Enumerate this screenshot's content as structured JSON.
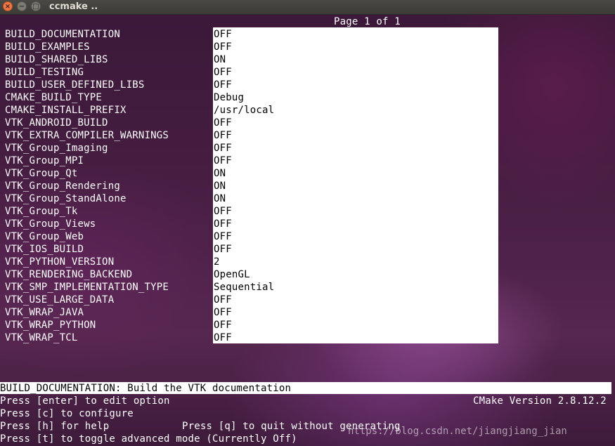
{
  "window": {
    "title": "ccmake ..",
    "close_glyph": "×",
    "minimize_glyph": "−",
    "maximize_glyph": "□"
  },
  "page_indicator": "Page 1 of 1",
  "options": [
    {
      "name": "BUILD_DOCUMENTATION",
      "value": "OFF"
    },
    {
      "name": "BUILD_EXAMPLES",
      "value": "OFF"
    },
    {
      "name": "BUILD_SHARED_LIBS",
      "value": "ON"
    },
    {
      "name": "BUILD_TESTING",
      "value": "OFF"
    },
    {
      "name": "BUILD_USER_DEFINED_LIBS",
      "value": "OFF"
    },
    {
      "name": "CMAKE_BUILD_TYPE",
      "value": "Debug"
    },
    {
      "name": "CMAKE_INSTALL_PREFIX",
      "value": "/usr/local"
    },
    {
      "name": "VTK_ANDROID_BUILD",
      "value": "OFF"
    },
    {
      "name": "VTK_EXTRA_COMPILER_WARNINGS",
      "value": "OFF"
    },
    {
      "name": "VTK_Group_Imaging",
      "value": "OFF"
    },
    {
      "name": "VTK_Group_MPI",
      "value": "OFF"
    },
    {
      "name": "VTK_Group_Qt",
      "value": "ON"
    },
    {
      "name": "VTK_Group_Rendering",
      "value": "ON"
    },
    {
      "name": "VTK_Group_StandAlone",
      "value": "ON"
    },
    {
      "name": "VTK_Group_Tk",
      "value": "OFF"
    },
    {
      "name": "VTK_Group_Views",
      "value": "OFF"
    },
    {
      "name": "VTK_Group_Web",
      "value": "OFF"
    },
    {
      "name": "VTK_IOS_BUILD",
      "value": "OFF"
    },
    {
      "name": "VTK_PYTHON_VERSION",
      "value": "2"
    },
    {
      "name": "VTK_RENDERING_BACKEND",
      "value": "OpenGL"
    },
    {
      "name": "VTK_SMP_IMPLEMENTATION_TYPE",
      "value": "Sequential"
    },
    {
      "name": "VTK_USE_LARGE_DATA",
      "value": "OFF"
    },
    {
      "name": "VTK_WRAP_JAVA",
      "value": "OFF"
    },
    {
      "name": "VTK_WRAP_PYTHON",
      "value": "OFF"
    },
    {
      "name": "VTK_WRAP_TCL",
      "value": "OFF"
    }
  ],
  "description": "BUILD_DOCUMENTATION: Build the VTK documentation",
  "help": {
    "edit": "Press [enter] to edit option",
    "configure": "Press [c] to configure",
    "help": "Press [h] for help",
    "quit": "Press [q] to quit without generating",
    "toggle": "Press [t] to toggle advanced mode (Currently Off)"
  },
  "version": "CMake Version 2.8.12.2",
  "watermark": "https://blog.csdn.net/jiangjiang_jian",
  "colors": {
    "value_background": "#ffffff",
    "text": "#ffffff",
    "value_text": "#000000"
  }
}
